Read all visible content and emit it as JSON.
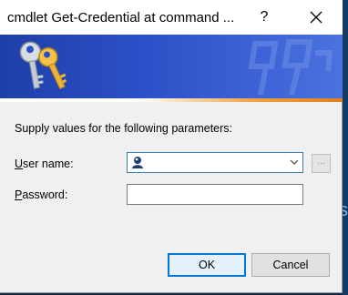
{
  "window": {
    "title": "cmdlet Get-Credential at command ...",
    "help_label": "?",
    "close_icon": "close-icon"
  },
  "banner": {
    "icon": "keys-icon",
    "watermark": "keys-watermark-icon",
    "colors": {
      "blue": "#2b4fc6",
      "accent": "#e08020"
    }
  },
  "form": {
    "prompt": "Supply values for the following parameters:",
    "user_label_hotkey": "U",
    "user_label_rest": "ser name:",
    "user_value": "",
    "password_label_hotkey": "P",
    "password_label_rest": "assword:",
    "password_value": "",
    "browse_label": "..."
  },
  "buttons": {
    "ok": "OK",
    "cancel": "Cancel"
  },
  "background": {
    "fragment": "s"
  }
}
